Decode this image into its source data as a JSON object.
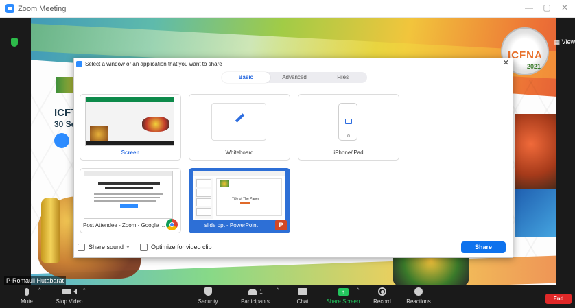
{
  "window": {
    "title": "Zoom Meeting",
    "minimize": "—",
    "restore": "▢",
    "close": "✕"
  },
  "meeting": {
    "view_label": "View",
    "participant_name": "P-Romauli Hutabarat",
    "slide": {
      "text1": "ICFT",
      "text2": "30 Se",
      "seal_text": "ICFNA",
      "seal_year": "2021"
    }
  },
  "dialog": {
    "title": "Select a window or an application that you want to share",
    "close": "✕",
    "tabs": [
      {
        "label": "Basic",
        "active": true
      },
      {
        "label": "Advanced",
        "active": false
      },
      {
        "label": "Files",
        "active": false
      }
    ],
    "cards": {
      "screen": "Screen",
      "whiteboard": "Whiteboard",
      "iphone": "iPhone/iPad",
      "chrome": "Post Attendee - Zoom - Google ...",
      "powerpoint": "slide ppt - PowerPoint"
    },
    "ppt_thumb_title": "Title of The Paper",
    "ppt_badge": "P",
    "share_sound": "Share sound",
    "sound_caret": "⌄",
    "optimize": "Optimize for video clip",
    "share_button": "Share",
    "accent_color": "#0e72ed"
  },
  "toolbar": {
    "mute": "Mute",
    "stop_video": "Stop Video",
    "security": "Security",
    "participants": "Participants",
    "participants_count": "1",
    "chat": "Chat",
    "share_screen": "Share Screen",
    "record": "Record",
    "reactions": "Reactions",
    "end": "End",
    "caret": "^"
  },
  "icons": [
    "microphone-icon",
    "video-camera-icon",
    "shield-icon",
    "participants-icon",
    "chat-icon",
    "share-screen-icon",
    "record-icon",
    "reactions-icon",
    "pencil-icon",
    "iphone-icon",
    "chrome-icon",
    "powerpoint-icon"
  ]
}
